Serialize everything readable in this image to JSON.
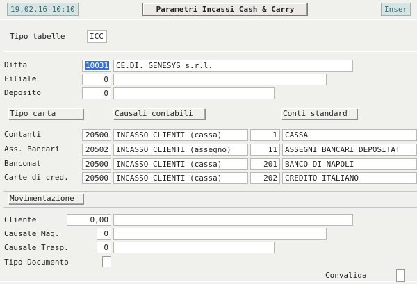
{
  "header": {
    "datetime": "19.02.16 10:10",
    "title": "Parametri Incassi Cash & Carry",
    "mode": "Inser"
  },
  "tipo_tabelle": {
    "label": "Tipo tabelle",
    "value": "ICC"
  },
  "ditta": {
    "label": "Ditta",
    "code": "10031",
    "name": "CE.DI. GENESYS s.r.l."
  },
  "filiale": {
    "label": "Filiale",
    "code": "0",
    "name": ""
  },
  "deposito": {
    "label": "Deposito",
    "code": "0",
    "name": ""
  },
  "columns": {
    "tipo_carta": "Tipo carta",
    "causali": "Causali contabili",
    "conti": "Conti standard"
  },
  "payment_rows": [
    {
      "label": "Contanti",
      "causale_code": "20500",
      "causale_desc": "INCASSO CLIENTI (cassa)",
      "conto_code": "1",
      "conto_desc": "CASSA"
    },
    {
      "label": "Ass. Bancari",
      "causale_code": "20502",
      "causale_desc": "INCASSO CLIENTI (assegno)",
      "conto_code": "11",
      "conto_desc": "ASSEGNI BANCARI DEPOSITAT"
    },
    {
      "label": "Bancomat",
      "causale_code": "20500",
      "causale_desc": "INCASSO CLIENTI (cassa)",
      "conto_code": "201",
      "conto_desc": "BANCO DI NAPOLI"
    },
    {
      "label": "Carte di cred.",
      "causale_code": "20500",
      "causale_desc": "INCASSO CLIENTI (cassa)",
      "conto_code": "202",
      "conto_desc": "CREDITO ITALIANO"
    }
  ],
  "movimentazione": {
    "section_label": "Movimentazione",
    "cliente": {
      "label": "Cliente",
      "code": "0,00",
      "name": ""
    },
    "causale_mag": {
      "label": "Causale Mag.",
      "code": "0",
      "name": ""
    },
    "causale_trasp": {
      "label": "Causale Trasp.",
      "code": "0",
      "name": ""
    },
    "tipo_documento": {
      "label": "Tipo Documento",
      "checked": false
    }
  },
  "footer": {
    "convalida_label": "Convalida",
    "checked": false
  }
}
